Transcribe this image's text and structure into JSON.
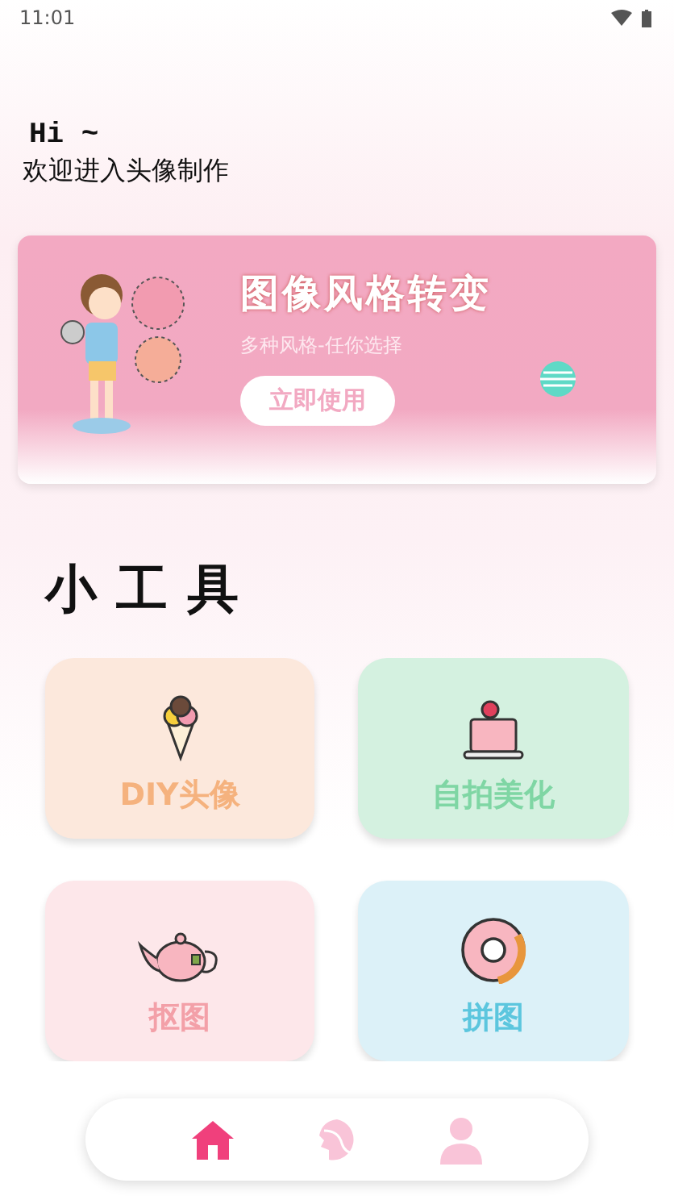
{
  "status_bar": {
    "time": "11:01"
  },
  "greeting": {
    "title": "Hi ~",
    "subtitle": "欢迎进入头像制作"
  },
  "banner": {
    "title": "图像风格转变",
    "subtitle": "多种风格-任你选择",
    "button": "立即使用"
  },
  "section_title": "小工具",
  "tools": [
    {
      "label": "DIY头像",
      "kind": "icecream",
      "color": "#f5b27e"
    },
    {
      "label": "自拍美化",
      "kind": "cake",
      "color": "#7fd6a4"
    },
    {
      "label": "抠图",
      "kind": "teapot",
      "color": "#f3a0a8"
    },
    {
      "label": "拼图",
      "kind": "donut",
      "color": "#5cc6de"
    }
  ],
  "nav": [
    {
      "kind": "home",
      "selected": true
    },
    {
      "kind": "face",
      "selected": false
    },
    {
      "kind": "user",
      "selected": false
    }
  ]
}
